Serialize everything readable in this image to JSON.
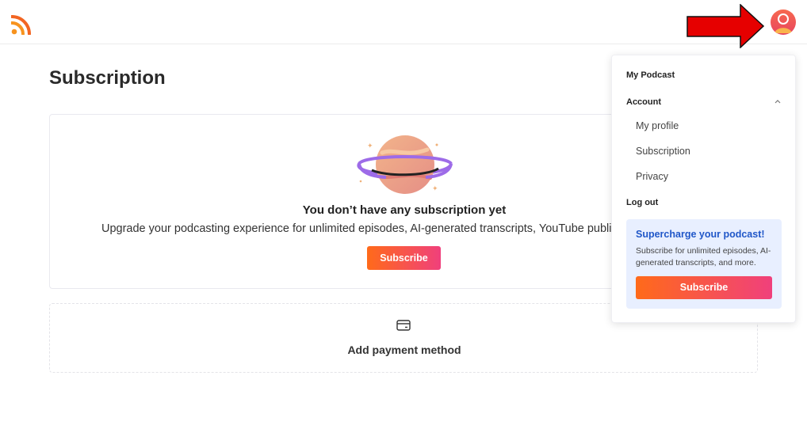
{
  "page": {
    "title": "Subscription"
  },
  "empty_state": {
    "title": "You don’t have any subscription yet",
    "description": "Upgrade your podcasting experience for unlimited episodes, AI-generated transcripts, YouTube publishing",
    "subscribe_label": "Subscribe"
  },
  "payment": {
    "add_label": "Add payment method",
    "icon": "credit-card-icon"
  },
  "menu": {
    "my_podcast": "My Podcast",
    "account": "Account",
    "my_profile": "My profile",
    "subscription": "Subscription",
    "privacy": "Privacy",
    "logout": "Log out"
  },
  "promo": {
    "title": "Supercharge your podcast!",
    "description": "Subscribe for unlimited episodes, AI-generated transcripts, and more.",
    "button_label": "Subscribe"
  },
  "colors": {
    "accent_start": "#ff6a1a",
    "accent_end": "#f0407c",
    "promo_title": "#2057c8",
    "promo_bg": "#e8efff",
    "arrow": "#e60000"
  },
  "icons": [
    "rss-icon",
    "avatar",
    "planet-illustration",
    "chevron-up-icon",
    "credit-card-icon"
  ]
}
